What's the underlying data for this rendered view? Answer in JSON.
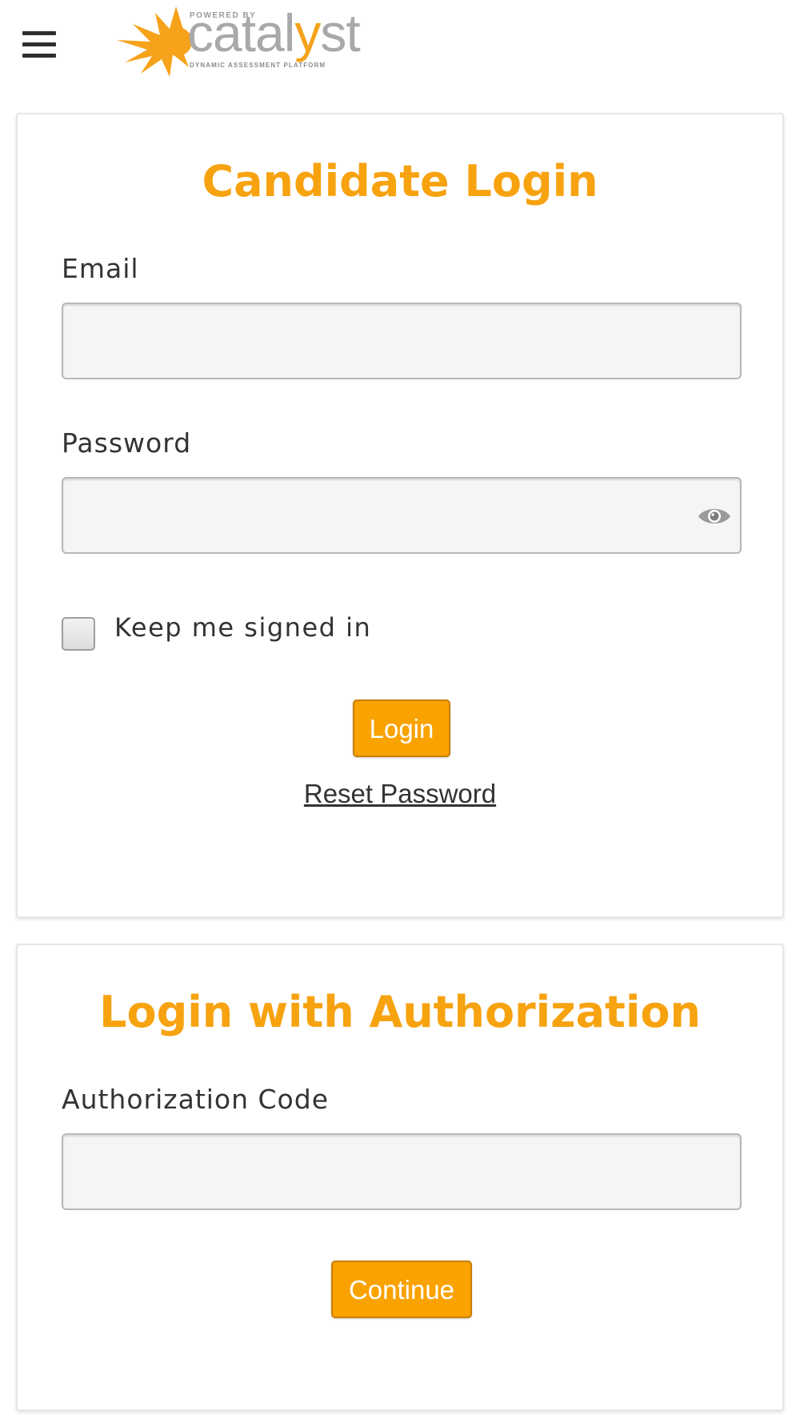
{
  "header": {
    "menu_icon": "hamburger-menu-icon",
    "logo": {
      "powered_by": "POWERED BY",
      "word_part1": "catal",
      "word_part2": "y",
      "word_part3": "st",
      "tagline": "DYNAMIC ASSESSMENT PLATFORM",
      "icon": "starburst-logo-icon"
    }
  },
  "login_card": {
    "title": "Candidate Login",
    "email_label": "Email",
    "email_value": "",
    "password_label": "Password",
    "password_value": "",
    "password_toggle_icon": "eye-icon",
    "keep_signed_in_label": "Keep me signed in",
    "keep_signed_in_checked": false,
    "login_button": "Login",
    "reset_password_link": "Reset Password"
  },
  "auth_card": {
    "title": "Login with Authorization",
    "code_label": "Authorization Code",
    "code_value": "",
    "continue_button": "Continue"
  },
  "colors": {
    "accent": "#f7a20f",
    "button_bg": "#f9a200",
    "logo_gray": "#a9a9a9"
  }
}
